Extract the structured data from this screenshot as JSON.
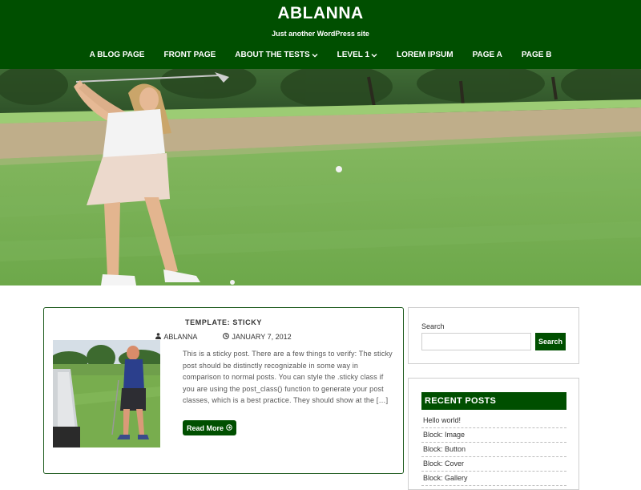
{
  "site": {
    "title": "ABLANNA",
    "tagline": "Just another WordPress site"
  },
  "nav": {
    "items": [
      {
        "label": "A BLOG PAGE",
        "has_submenu": false
      },
      {
        "label": "FRONT PAGE",
        "has_submenu": false
      },
      {
        "label": "ABOUT THE TESTS",
        "has_submenu": true
      },
      {
        "label": "LEVEL 1",
        "has_submenu": true
      },
      {
        "label": "LOREM IPSUM",
        "has_submenu": false
      },
      {
        "label": "PAGE A",
        "has_submenu": false
      },
      {
        "label": "PAGE B",
        "has_submenu": false
      }
    ]
  },
  "post": {
    "category": "TEMPLATE: STICKY",
    "author": "ABLANNA",
    "date": "JANUARY 7, 2012",
    "excerpt": "This is a sticky post. There are a few things to verify: The sticky post should be distinctly recognizable in some way in comparison to normal posts. You can style the .sticky class if you are using the post_class() function to generate your post classes, which is a best practice. They should show at the […]",
    "read_more": "Read More"
  },
  "search_widget": {
    "label": "Search",
    "placeholder": "",
    "button": "Search"
  },
  "recent_posts": {
    "title": "RECENT POSTS",
    "items": [
      "Hello world!",
      "Block: Image",
      "Block: Button",
      "Block: Cover",
      "Block: Gallery"
    ]
  },
  "colors": {
    "brand_green": "#004f00",
    "border_green": "#1d5a1d"
  },
  "icons": {
    "author": "user-icon",
    "date": "clock-icon",
    "read_more": "arrow-circle-right-icon",
    "submenu": "chevron-down-icon"
  }
}
